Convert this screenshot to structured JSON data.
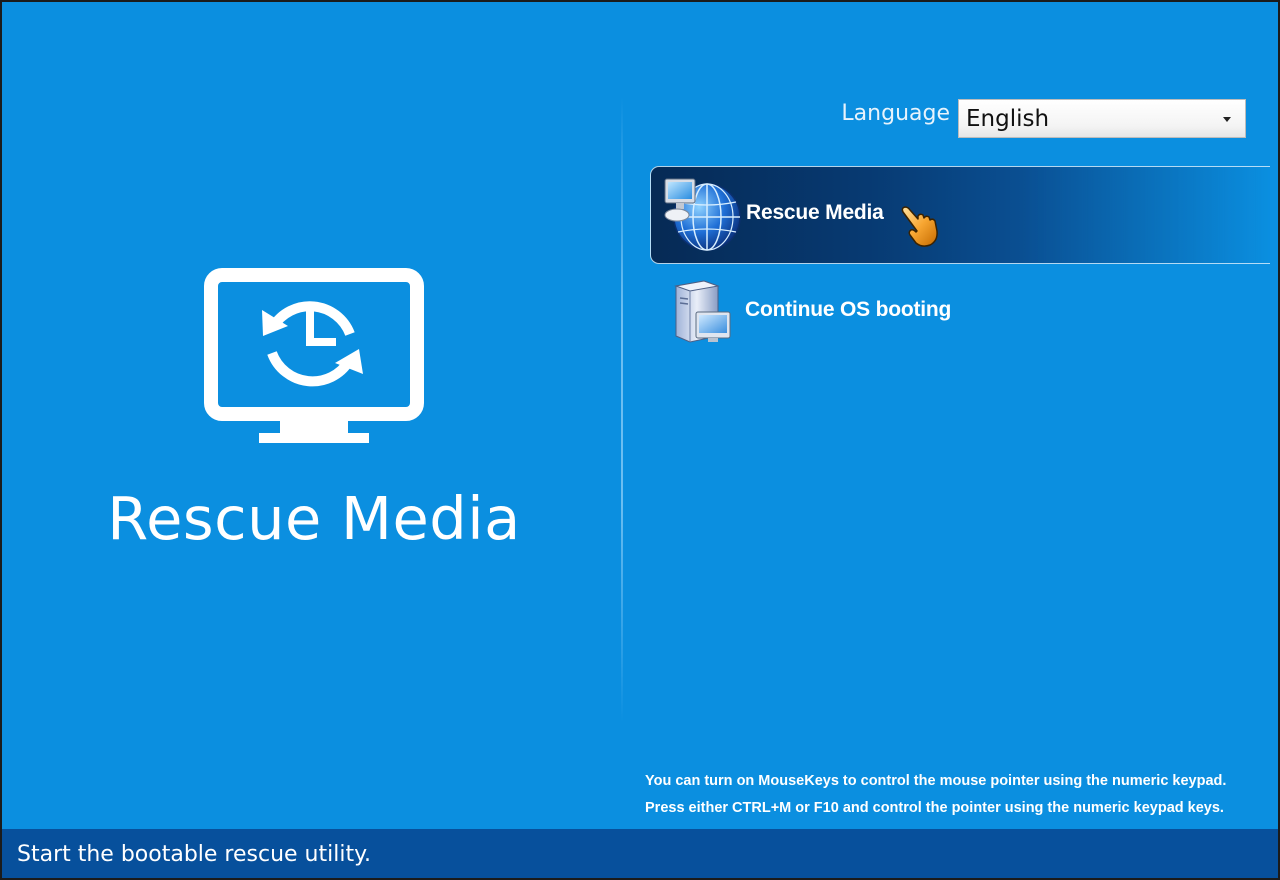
{
  "left_panel": {
    "title": "Rescue Media",
    "icon": "monitor-clock-icon"
  },
  "language": {
    "label": "Language",
    "selected": "English"
  },
  "menu": {
    "items": [
      {
        "label": "Rescue Media",
        "icon": "globe-computer-icon",
        "selected": true
      },
      {
        "label": "Continue OS booting",
        "icon": "computer-tower-icon",
        "selected": false
      }
    ]
  },
  "hint": {
    "line1": "You can turn on MouseKeys to control the mouse pointer using the numeric keypad.",
    "line2": "Press either CTRL+M or F10 and control the pointer using the numeric keypad keys."
  },
  "status_bar": {
    "text": "Start the bootable rescue utility."
  },
  "colors": {
    "background": "#0b8fe0",
    "status_bar": "#07509c",
    "selected_item": "#073a72"
  }
}
